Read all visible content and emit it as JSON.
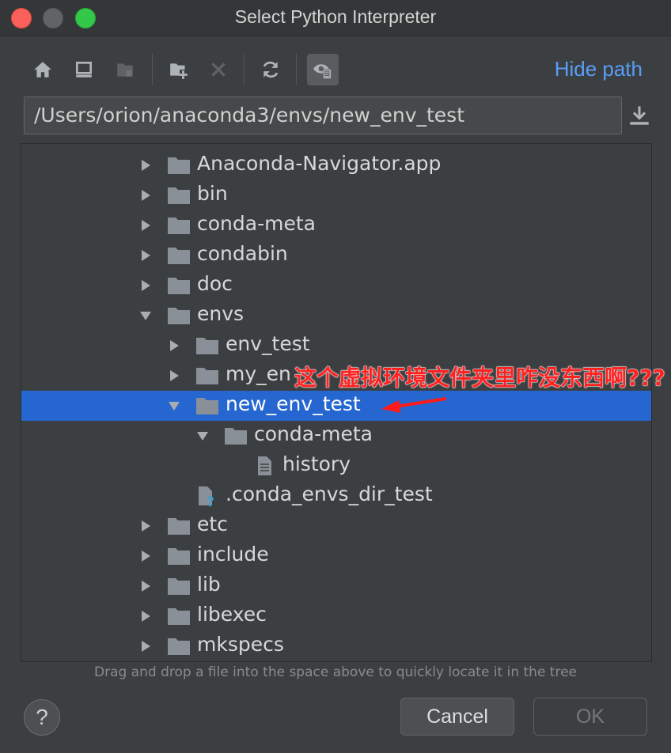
{
  "window": {
    "title": "Select Python Interpreter"
  },
  "toolbar": {
    "buttons": [
      {
        "name": "home-icon"
      },
      {
        "name": "desktop-icon"
      },
      {
        "name": "project-folder-icon"
      },
      {
        "name": "new-folder-icon"
      },
      {
        "name": "delete-icon"
      },
      {
        "name": "refresh-icon"
      },
      {
        "name": "show-hidden-icon"
      }
    ],
    "hide_path_label": "Hide path"
  },
  "path": {
    "value": "/Users/orion/anaconda3/envs/new_env_test"
  },
  "tree": {
    "items": [
      {
        "label": "Anaconda-Navigator.app",
        "type": "folder",
        "depth": 0,
        "expanded": false
      },
      {
        "label": "bin",
        "type": "folder",
        "depth": 0,
        "expanded": false
      },
      {
        "label": "conda-meta",
        "type": "folder",
        "depth": 0,
        "expanded": false
      },
      {
        "label": "condabin",
        "type": "folder",
        "depth": 0,
        "expanded": false
      },
      {
        "label": "doc",
        "type": "folder",
        "depth": 0,
        "expanded": false
      },
      {
        "label": "envs",
        "type": "folder",
        "depth": 0,
        "expanded": true
      },
      {
        "label": "env_test",
        "type": "folder",
        "depth": 1,
        "expanded": false
      },
      {
        "label": "my_en",
        "type": "folder",
        "depth": 1,
        "expanded": false
      },
      {
        "label": "new_env_test",
        "type": "folder",
        "depth": 1,
        "expanded": true,
        "selected": true
      },
      {
        "label": "conda-meta",
        "type": "folder",
        "depth": 2,
        "expanded": true
      },
      {
        "label": "history",
        "type": "file",
        "depth": 3
      },
      {
        "label": ".conda_envs_dir_test",
        "type": "unknown-file",
        "depth": 1
      },
      {
        "label": "etc",
        "type": "folder",
        "depth": 0,
        "expanded": false
      },
      {
        "label": "include",
        "type": "folder",
        "depth": 0,
        "expanded": false
      },
      {
        "label": "lib",
        "type": "folder",
        "depth": 0,
        "expanded": false
      },
      {
        "label": "libexec",
        "type": "folder",
        "depth": 0,
        "expanded": false
      },
      {
        "label": "mkspecs",
        "type": "folder",
        "depth": 0,
        "expanded": false
      }
    ]
  },
  "hint": "Drag and drop a file into the space above to quickly locate it in the tree",
  "annotation": {
    "text": "这个虚拟环境文件夹里咋没东西啊???",
    "color": "#ff2020"
  },
  "buttons": {
    "help": "?",
    "cancel": "Cancel",
    "ok": "OK"
  },
  "colors": {
    "accent": "#589df6",
    "selection": "#2566d1",
    "background": "#3c3f41"
  }
}
